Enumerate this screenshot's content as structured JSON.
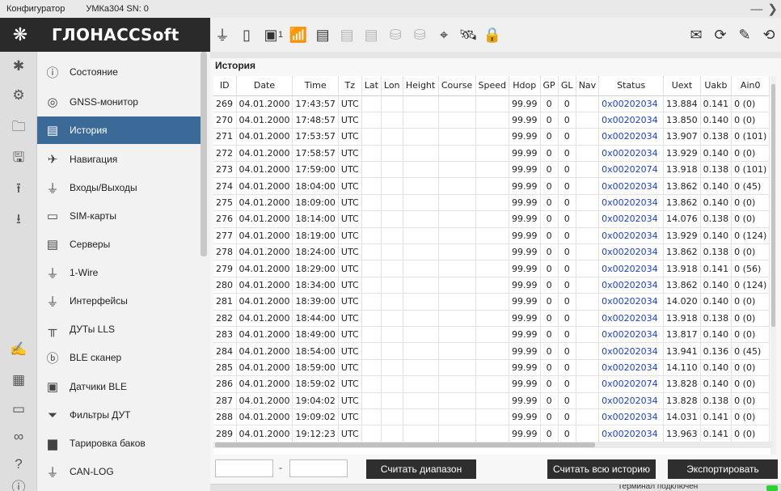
{
  "window": {
    "app_name": "Конфигуратор",
    "device": "УМКа304 SN: 0",
    "minimize_glyph": "—",
    "close_glyph": "❯"
  },
  "brand": {
    "name": "ГЛОНАССSoft"
  },
  "toolbar": {
    "sim_count": "1",
    "icons": [
      "usb-icon",
      "sim-icon",
      "antenna-icon",
      "device-icon",
      "device-2-icon",
      "device-3-icon",
      "device-4-icon",
      "device-5-icon",
      "location-off-icon",
      "satellite-icon",
      "lock-icon",
      "mail-icon",
      "refresh-icon",
      "signature-icon",
      "reset-icon"
    ]
  },
  "nav": {
    "items": [
      {
        "label": "Состояние",
        "icon": "info-icon"
      },
      {
        "label": "GNSS-монитор",
        "icon": "gnss-icon"
      },
      {
        "label": "История",
        "icon": "history-icon"
      },
      {
        "label": "Навигация",
        "icon": "satellite-icon"
      },
      {
        "label": "Входы/Выходы",
        "icon": "io-icon"
      },
      {
        "label": "SIM-карты",
        "icon": "sim-icon"
      },
      {
        "label": "Серверы",
        "icon": "server-icon"
      },
      {
        "label": "1-Wire",
        "icon": "plug-icon"
      },
      {
        "label": "Интерфейсы",
        "icon": "plug-icon"
      },
      {
        "label": "ДУТы LLS",
        "icon": "fuel-sensor-icon"
      },
      {
        "label": "BLE сканер",
        "icon": "bluetooth-icon"
      },
      {
        "label": "Датчики BLE",
        "icon": "ble-sensor-icon"
      },
      {
        "label": "Фильтры ДУТ",
        "icon": "filter-icon"
      },
      {
        "label": "Тарировка баков",
        "icon": "tank-icon"
      },
      {
        "label": "CAN-LOG",
        "icon": "plug-icon"
      }
    ],
    "active_index": 2
  },
  "history": {
    "title": "История",
    "columns": [
      "ID",
      "Date",
      "Time",
      "Tz",
      "Lat",
      "Lon",
      "Height",
      "Course",
      "Speed",
      "Hdop",
      "GP",
      "GL",
      "Nav",
      "Status",
      "Uext",
      "Uakb",
      "Ain0"
    ],
    "rows": [
      [
        "269",
        "04.01.2000",
        "17:43:57",
        "UTC",
        "",
        "",
        "",
        "",
        "",
        "99.99",
        "0",
        "0",
        "",
        "0x00202034",
        "13.884",
        "0.141",
        "0 (0)"
      ],
      [
        "270",
        "04.01.2000",
        "17:48:57",
        "UTC",
        "",
        "",
        "",
        "",
        "",
        "99.99",
        "0",
        "0",
        "",
        "0x00202034",
        "13.850",
        "0.140",
        "0 (0)"
      ],
      [
        "271",
        "04.01.2000",
        "17:53:57",
        "UTC",
        "",
        "",
        "",
        "",
        "",
        "99.99",
        "0",
        "0",
        "",
        "0x00202034",
        "13.907",
        "0.138",
        "0 (101)"
      ],
      [
        "272",
        "04.01.2000",
        "17:58:57",
        "UTC",
        "",
        "",
        "",
        "",
        "",
        "99.99",
        "0",
        "0",
        "",
        "0x00202034",
        "13.929",
        "0.140",
        "0 (0)"
      ],
      [
        "273",
        "04.01.2000",
        "17:59:00",
        "UTC",
        "",
        "",
        "",
        "",
        "",
        "99.99",
        "0",
        "0",
        "",
        "0x00202074",
        "13.918",
        "0.138",
        "0 (101)"
      ],
      [
        "274",
        "04.01.2000",
        "18:04:00",
        "UTC",
        "",
        "",
        "",
        "",
        "",
        "99.99",
        "0",
        "0",
        "",
        "0x00202034",
        "13.862",
        "0.140",
        "0 (45)"
      ],
      [
        "275",
        "04.01.2000",
        "18:09:00",
        "UTC",
        "",
        "",
        "",
        "",
        "",
        "99.99",
        "0",
        "0",
        "",
        "0x00202034",
        "13.862",
        "0.140",
        "0 (0)"
      ],
      [
        "276",
        "04.01.2000",
        "18:14:00",
        "UTC",
        "",
        "",
        "",
        "",
        "",
        "99.99",
        "0",
        "0",
        "",
        "0x00202034",
        "14.076",
        "0.138",
        "0 (0)"
      ],
      [
        "277",
        "04.01.2000",
        "18:19:00",
        "UTC",
        "",
        "",
        "",
        "",
        "",
        "99.99",
        "0",
        "0",
        "",
        "0x00202034",
        "13.929",
        "0.140",
        "0 (124)"
      ],
      [
        "278",
        "04.01.2000",
        "18:24:00",
        "UTC",
        "",
        "",
        "",
        "",
        "",
        "99.99",
        "0",
        "0",
        "",
        "0x00202034",
        "13.862",
        "0.138",
        "0 (0)"
      ],
      [
        "279",
        "04.01.2000",
        "18:29:00",
        "UTC",
        "",
        "",
        "",
        "",
        "",
        "99.99",
        "0",
        "0",
        "",
        "0x00202034",
        "13.918",
        "0.141",
        "0 (56)"
      ],
      [
        "280",
        "04.01.2000",
        "18:34:00",
        "UTC",
        "",
        "",
        "",
        "",
        "",
        "99.99",
        "0",
        "0",
        "",
        "0x00202034",
        "13.862",
        "0.140",
        "0 (124)"
      ],
      [
        "281",
        "04.01.2000",
        "18:39:00",
        "UTC",
        "",
        "",
        "",
        "",
        "",
        "99.99",
        "0",
        "0",
        "",
        "0x00202034",
        "14.020",
        "0.140",
        "0 (0)"
      ],
      [
        "282",
        "04.01.2000",
        "18:44:00",
        "UTC",
        "",
        "",
        "",
        "",
        "",
        "99.99",
        "0",
        "0",
        "",
        "0x00202034",
        "13.918",
        "0.138",
        "0 (0)"
      ],
      [
        "283",
        "04.01.2000",
        "18:49:00",
        "UTC",
        "",
        "",
        "",
        "",
        "",
        "99.99",
        "0",
        "0",
        "",
        "0x00202034",
        "13.817",
        "0.140",
        "0 (0)"
      ],
      [
        "284",
        "04.01.2000",
        "18:54:00",
        "UTC",
        "",
        "",
        "",
        "",
        "",
        "99.99",
        "0",
        "0",
        "",
        "0x00202034",
        "13.941",
        "0.136",
        "0 (45)"
      ],
      [
        "285",
        "04.01.2000",
        "18:59:00",
        "UTC",
        "",
        "",
        "",
        "",
        "",
        "99.99",
        "0",
        "0",
        "",
        "0x00202034",
        "14.110",
        "0.140",
        "0 (0)"
      ],
      [
        "286",
        "04.01.2000",
        "18:59:02",
        "UTC",
        "",
        "",
        "",
        "",
        "",
        "99.99",
        "0",
        "0",
        "",
        "0x00202074",
        "13.828",
        "0.140",
        "0 (0)"
      ],
      [
        "287",
        "04.01.2000",
        "19:04:02",
        "UTC",
        "",
        "",
        "",
        "",
        "",
        "99.99",
        "0",
        "0",
        "",
        "0x00202034",
        "13.828",
        "0.138",
        "0 (0)"
      ],
      [
        "288",
        "04.01.2000",
        "19:09:02",
        "UTC",
        "",
        "",
        "",
        "",
        "",
        "99.99",
        "0",
        "0",
        "",
        "0x00202034",
        "14.031",
        "0.141",
        "0 (0)"
      ],
      [
        "289",
        "04.01.2000",
        "19:12:23",
        "UTC",
        "",
        "",
        "",
        "",
        "",
        "99.99",
        "0",
        "0",
        "",
        "0x00202034",
        "13.963",
        "0.141",
        "0 (0)"
      ]
    ]
  },
  "range": {
    "from_value": "",
    "to_value": "",
    "separator": "-"
  },
  "buttons": {
    "read_range": "Считать диапазон",
    "read_all": "Считать всю историю",
    "export": "Экспортировать"
  },
  "status": {
    "text": "Терминал подключен",
    "indicator_color": "#2bd233"
  },
  "colors": {
    "accent": "#3b6a99",
    "header_dark": "#2a2a2a",
    "status_link": "#1a3fd6"
  }
}
